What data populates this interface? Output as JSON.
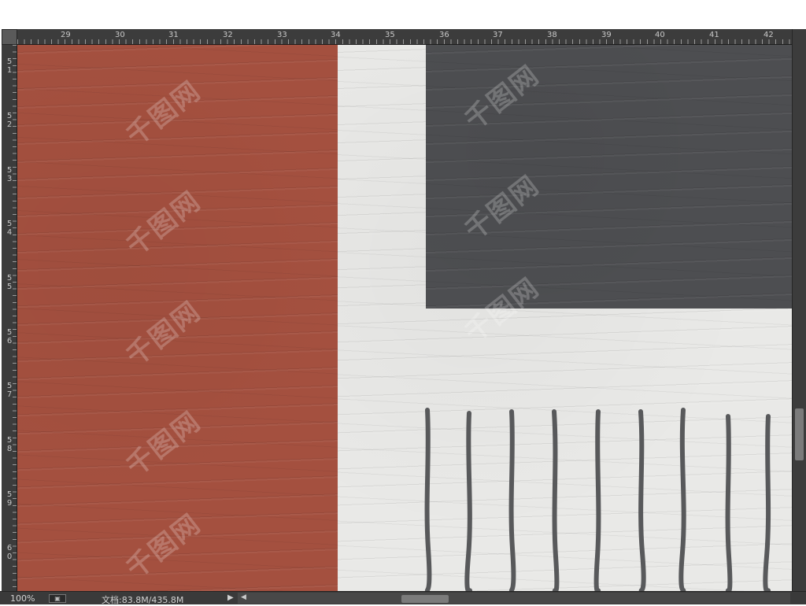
{
  "ruler": {
    "top_labels": [
      "29",
      "30",
      "31",
      "32",
      "33",
      "34",
      "35",
      "36",
      "37",
      "38",
      "39",
      "40",
      "41",
      "42"
    ],
    "left_labels": [
      "51",
      "52",
      "53",
      "54",
      "55",
      "56",
      "57",
      "58",
      "59",
      "60"
    ]
  },
  "colors": {
    "red_panel": "#a4503f",
    "grey_panel": "#4d4e51",
    "white_panel": "#e9e9e7",
    "ui_dark": "#3c3c3c",
    "stroke_lines": "#58595b"
  },
  "watermark": "千图网",
  "statusbar": {
    "zoom": "100%",
    "doc_info": "文档:83.8M/435.8M"
  },
  "icons": {
    "status_icon": "document-info-icon",
    "menu_arrow": "play-arrow-icon",
    "scroll_left": "scroll-left-arrow-icon"
  }
}
